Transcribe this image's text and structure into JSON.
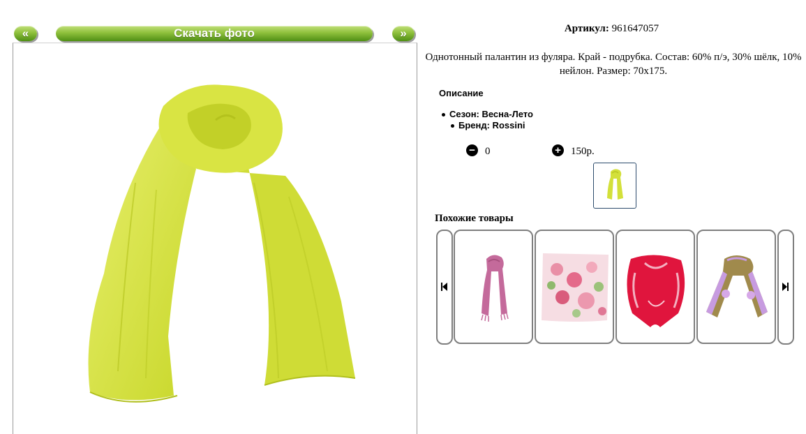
{
  "viewer": {
    "prev_label": "«",
    "download_label": "Скачать фото",
    "next_label": "»"
  },
  "product": {
    "sku_label": "Артикул:",
    "sku_value": "961647057",
    "description": "Однотонный палантин из фуляра. Край - подрубка. Состав: 60% п/э, 30% шёлк, 10% нейлон. Размер: 70x175.",
    "section_title": "Описание",
    "attributes": [
      {
        "text": "Сезон: Весна-Лето"
      },
      {
        "text": "Бренд: Rossini"
      }
    ],
    "quantity": "0",
    "price": "150р.",
    "color": "#d3e03a"
  },
  "similar": {
    "title": "Похожие товары",
    "items": [
      {
        "icon": "pink-scarf-image"
      },
      {
        "icon": "floral-scarf-image"
      },
      {
        "icon": "red-shawl-image"
      },
      {
        "icon": "purple-paisley-scarf-image"
      }
    ]
  },
  "icons": {
    "minus": "minus-circle-icon",
    "plus": "plus-circle-icon",
    "carousel_prev": "skip-previous-icon",
    "carousel_next": "skip-next-icon"
  },
  "colors": {
    "button_green": "#7fb52f",
    "frame_gray": "#9a9a9a"
  }
}
